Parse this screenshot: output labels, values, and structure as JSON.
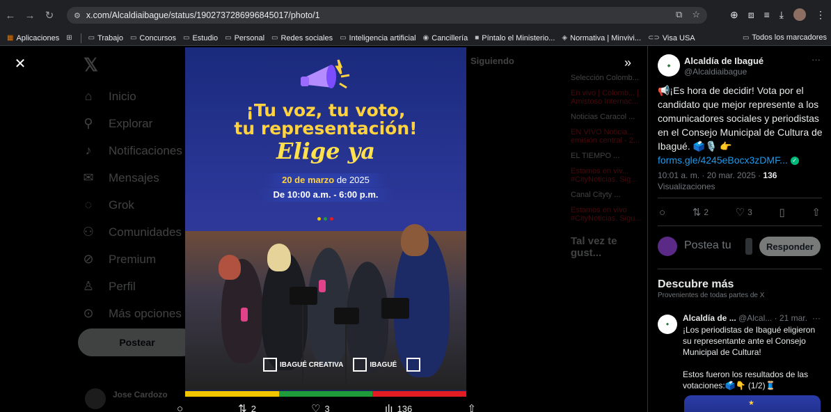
{
  "browser": {
    "url": "x.com/Alcaldiaibague/status/1902737286996845017/photo/1",
    "bookmarks": [
      "Aplicaciones",
      "Trabajo",
      "Concursos",
      "Estudio",
      "Personal",
      "Redes sociales",
      "Inteligencia artificial",
      "Cancillería",
      "Píntalo el Ministerio...",
      "Normativa | Minvivi...",
      "Visa USA"
    ],
    "all_bookmarks": "Todos los marcadores"
  },
  "background": {
    "nav": [
      "Inicio",
      "Explorar",
      "Notificaciones",
      "Mensajes",
      "Grok",
      "Comunidades",
      "Premium",
      "Perfil",
      "Más opciones"
    ],
    "nav_icons": [
      "home-icon",
      "search-icon",
      "bell-icon",
      "mail-icon",
      "grok-icon",
      "communities-icon",
      "premium-icon",
      "profile-icon",
      "more-icon"
    ],
    "post_button": "Postear",
    "user_name": "Jose Cardozo",
    "following_tab": "Siguiendo",
    "right_items": [
      "Selección Colomb...",
      "En vivo | Colomb... | Amistoso Internac...",
      "Noticias Caracol ...",
      "EN VIVO Noticia... emisión central - 2...",
      "EL TIEMPO ...",
      "Estamos en viv... #CityNoticias. Sig...",
      "Canal Cityty ...",
      "Estamos en vivo #CityNoticias. Sigu..."
    ],
    "right_title": "Tal vez te gust..."
  },
  "poster": {
    "headline1": "¡Tu voz, tu voto,",
    "headline2": "tu representación!",
    "script": "Elige ya",
    "date_bold": "20 de marzo",
    "date_rest": " de 2025",
    "time": "De 10:00 a.m. - 6:00 p.m.",
    "logo1": "IBAGUÉ CREATIVA",
    "logo2": "IBAGUÉ",
    "stripe_colors": [
      "#f2c500",
      "#1e9b3a",
      "#e31b23"
    ]
  },
  "media_actions": {
    "reply": "",
    "retweets": "2",
    "likes": "3",
    "views": "136"
  },
  "tweet": {
    "author": "Alcaldía de Ibagué",
    "handle": "@Alcaldiaibague",
    "text": "📢¡Es hora de decidir! Vota por el candidato que mejor represente a los comunicadores sociales y periodistas en el Consejo Municipal de Cultura de Ibagué. 🗳️🎙️ 👉",
    "link": "forms.gle/4245eBocx3zDMF...",
    "time": "10:01 a. m. · 20 mar. 2025 · ",
    "views_count": "136",
    "views_label": "Visualizaciones",
    "retweets": "2",
    "likes": "3",
    "reply_placeholder": "Postea tu",
    "reply_button": "Responder"
  },
  "discover": {
    "title": "Descubre más",
    "subtitle": "Provenientes de todas partes de X",
    "author": "Alcaldía de ...",
    "handle": "@Alcal...",
    "date": "· 21 mar.",
    "text1": "¡Los periodistas de Ibagué eligieron su representante ante el Consejo Municipal de Cultura!",
    "text2": "Estos fueron los resultados de las votaciones:🗳️👇 (1/2)🧵"
  }
}
